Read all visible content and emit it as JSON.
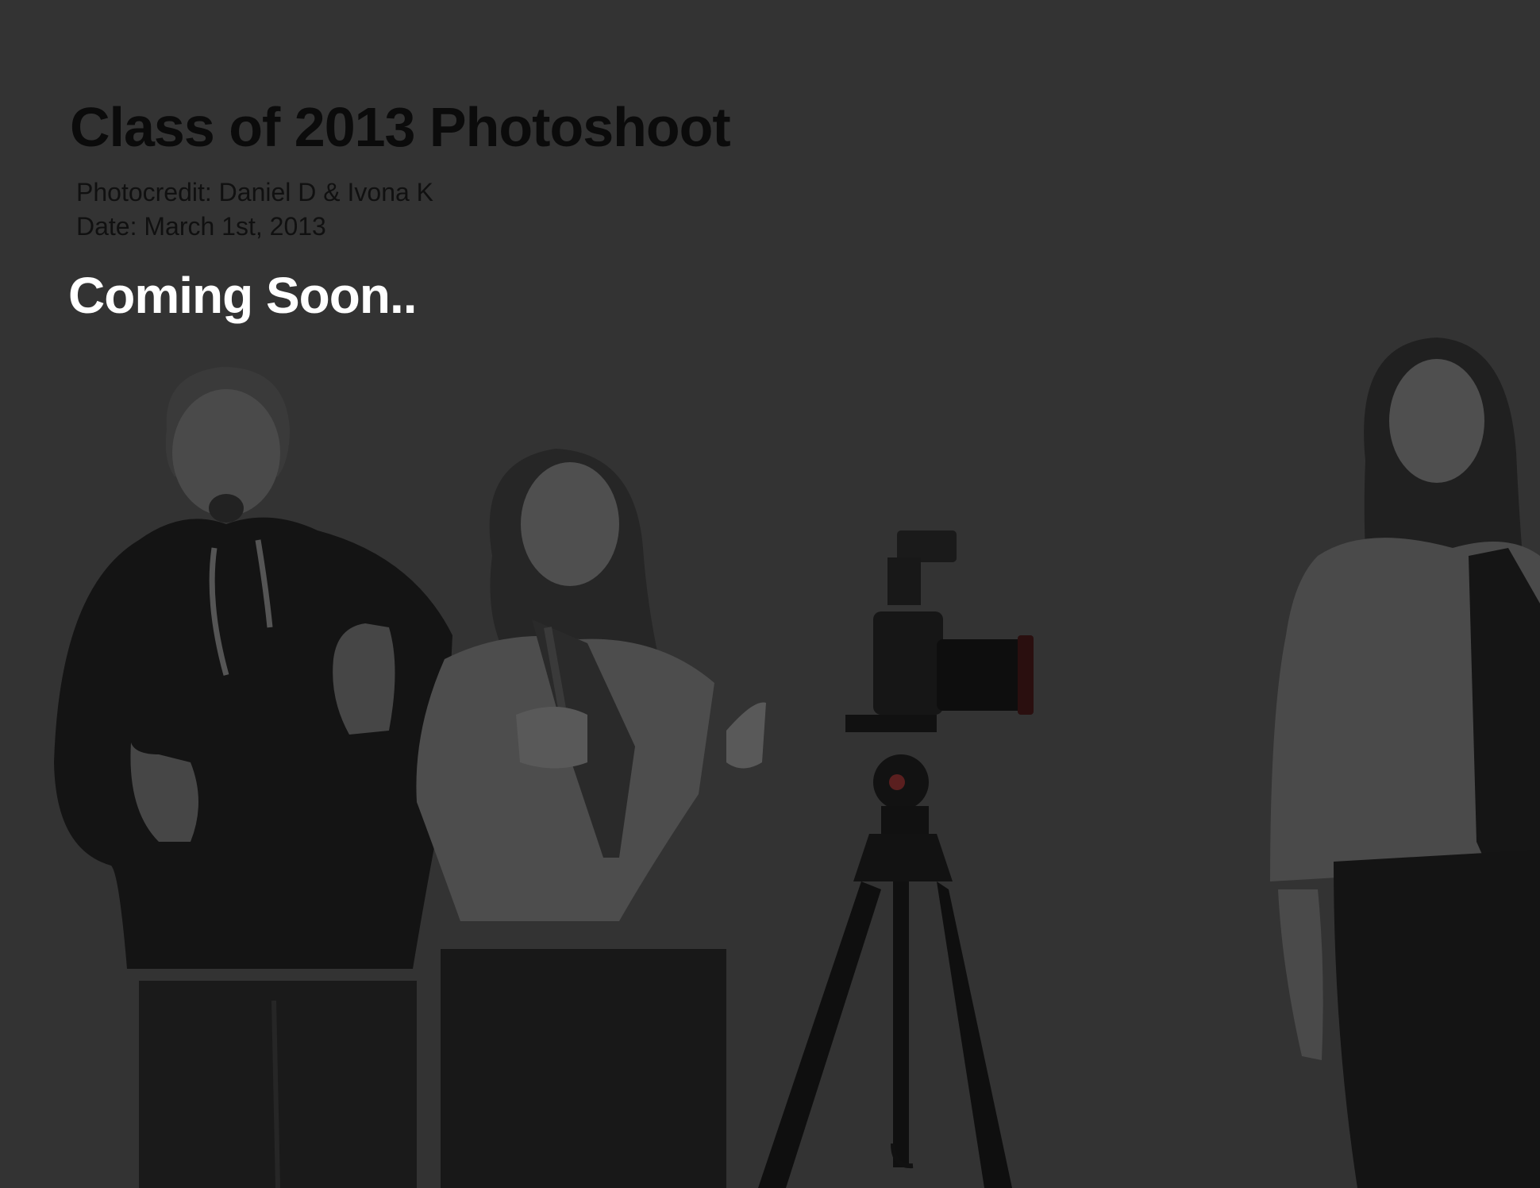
{
  "header": {
    "title": "Class of 2013 Photoshoot",
    "photocredit": "Photocredit: Daniel D & Ivona K",
    "date": "Date: March 1st, 2013",
    "status": "Coming Soon.."
  },
  "colors": {
    "background": "#333333",
    "title": "#0b0b0b",
    "status": "#ffffff"
  }
}
